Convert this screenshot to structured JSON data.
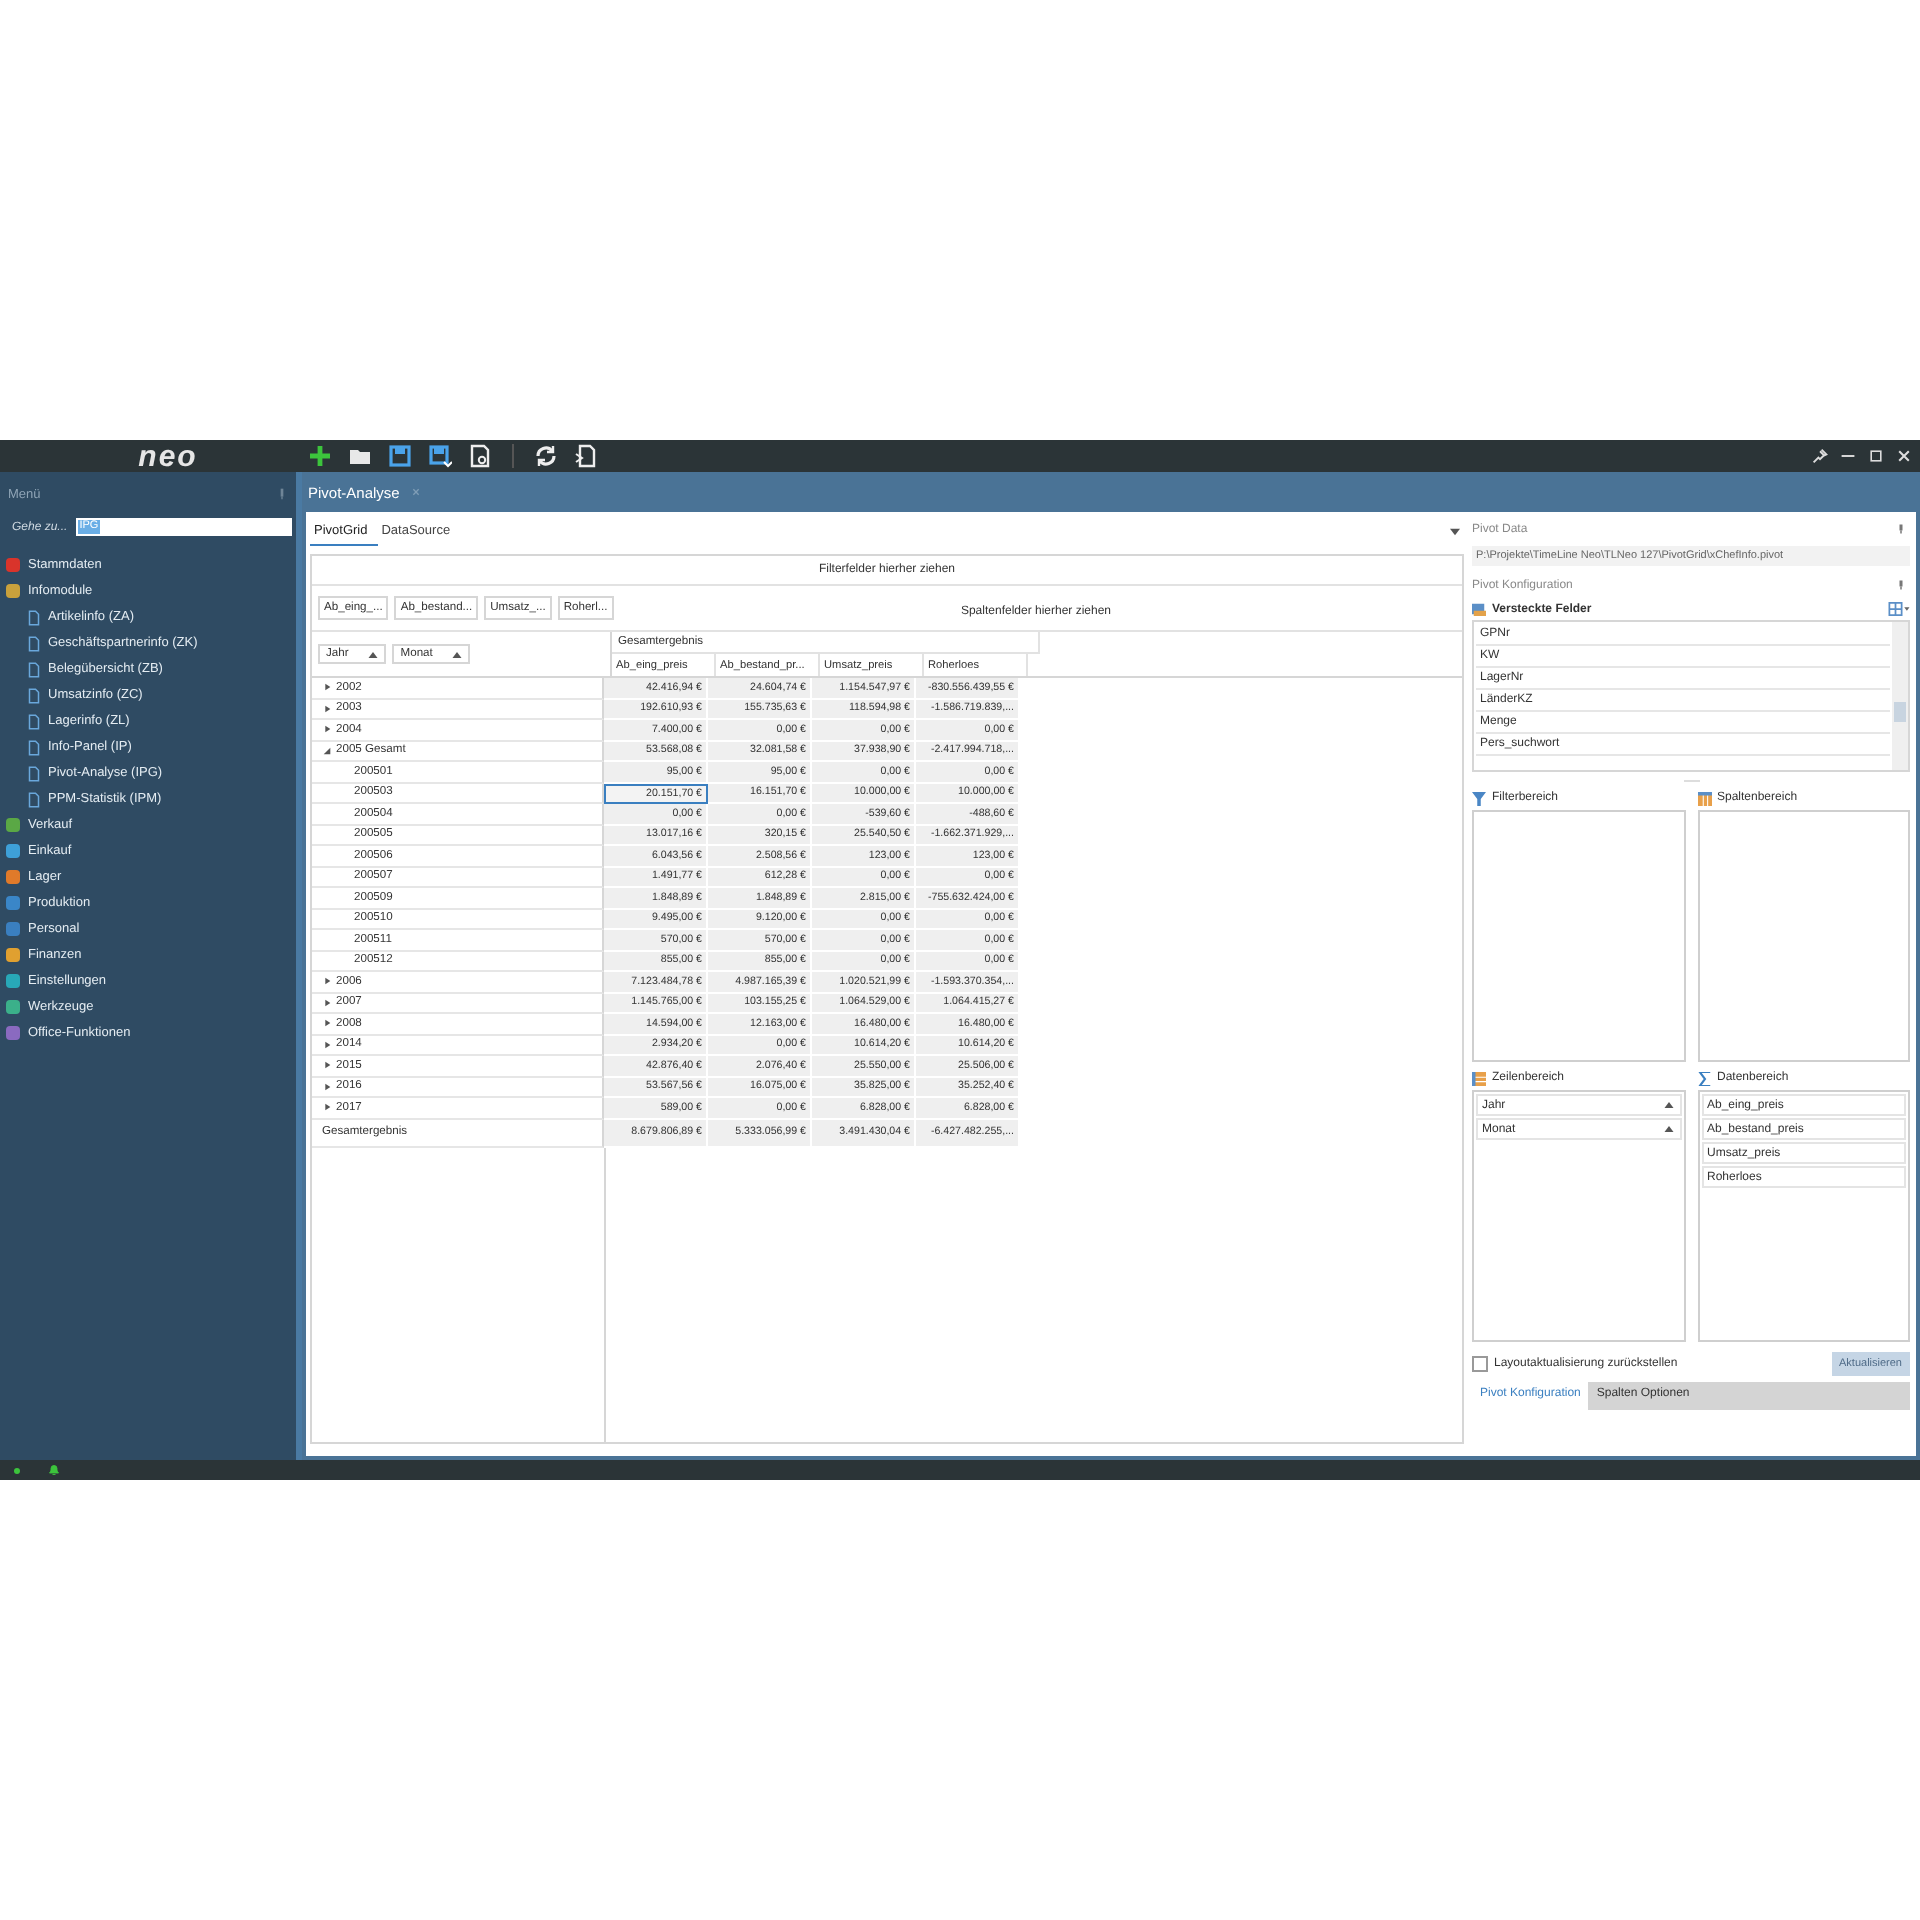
{
  "app": {
    "logo": "neo"
  },
  "sidebar": {
    "title": "Menü",
    "goto_label": "Gehe zu...",
    "goto_value": "IPG",
    "items": [
      {
        "label": "Stammdaten",
        "color": "#d9342b"
      },
      {
        "label": "Infomodule",
        "color": "#c9a13c",
        "children": [
          {
            "label": "Artikelinfo (ZA)"
          },
          {
            "label": "Geschäftspartnerinfo (ZK)"
          },
          {
            "label": "Belegübersicht (ZB)"
          },
          {
            "label": "Umsatzinfo (ZC)"
          },
          {
            "label": "Lagerinfo (ZL)"
          },
          {
            "label": "Info-Panel (IP)"
          },
          {
            "label": "Pivot-Analyse (IPG)"
          },
          {
            "label": "PPM-Statistik (IPM)"
          }
        ]
      },
      {
        "label": "Verkauf",
        "color": "#5aa845"
      },
      {
        "label": "Einkauf",
        "color": "#3ea0d8"
      },
      {
        "label": "Lager",
        "color": "#e07a2a"
      },
      {
        "label": "Produktion",
        "color": "#3a86c8"
      },
      {
        "label": "Personal",
        "color": "#3a7fc0"
      },
      {
        "label": "Finanzen",
        "color": "#e0a030"
      },
      {
        "label": "Einstellungen",
        "color": "#28a8b8"
      },
      {
        "label": "Werkzeuge",
        "color": "#3bb08a"
      },
      {
        "label": "Office-Funktionen",
        "color": "#8a6ac0"
      }
    ]
  },
  "document_tab": {
    "title": "Pivot-Analyse"
  },
  "view_tabs": [
    {
      "label": "PivotGrid",
      "selected": true
    },
    {
      "label": "DataSource",
      "selected": false
    }
  ],
  "pivot": {
    "filter_hint": "Filterfelder hierher ziehen",
    "data_fields": [
      "Ab_eing_...",
      "Ab_bestand...",
      "Umsatz_...",
      "Roherl..."
    ],
    "column_hint": "Spaltenfelder hierher ziehen",
    "row_fields": [
      "Jahr",
      "Monat"
    ],
    "grand_header": "Gesamtergebnis",
    "columns": [
      "Ab_eing_preis",
      "Ab_bestand_pr...",
      "Umsatz_preis",
      "Roherloes"
    ],
    "rows": [
      {
        "label": "2002",
        "expanded": false,
        "cells": [
          {
            "text": "42.416,94 €",
            "selected": false
          },
          {
            "text": "24.604,74 €",
            "selected": false
          },
          {
            "text": "1.154.547,97 €",
            "selected": false
          },
          {
            "text": "-830.556.439,55 €",
            "selected": false
          }
        ]
      },
      {
        "label": "2003",
        "expanded": false,
        "cells": [
          {
            "text": "192.610,93 €",
            "selected": false
          },
          {
            "text": "155.735,63 €",
            "selected": false
          },
          {
            "text": "118.594,98 €",
            "selected": false
          },
          {
            "text": "-1.586.719.839,...",
            "selected": false
          }
        ]
      },
      {
        "label": "2004",
        "expanded": false,
        "cells": [
          {
            "text": "7.400,00 €",
            "selected": false
          },
          {
            "text": "0,00 €",
            "selected": false
          },
          {
            "text": "0,00 €",
            "selected": false
          },
          {
            "text": "0,00 €",
            "selected": false
          }
        ]
      },
      {
        "label": "2005 Gesamt",
        "expanded": true,
        "cells": [
          {
            "text": "53.568,08 €",
            "selected": false
          },
          {
            "text": "32.081,58 €",
            "selected": false
          },
          {
            "text": "37.938,90 €",
            "selected": false
          },
          {
            "text": "-2.417.994.718,...",
            "selected": false
          }
        ],
        "children": [
          {
            "label": "200501",
            "cells": [
              {
                "text": "95,00 €",
                "selected": false
              },
              {
                "text": "95,00 €",
                "selected": false
              },
              {
                "text": "0,00 €",
                "selected": false
              },
              {
                "text": "0,00 €",
                "selected": false
              }
            ]
          },
          {
            "label": "200503",
            "cells": [
              {
                "text": "20.151,70 €",
                "selected": true
              },
              {
                "text": "16.151,70 €",
                "selected": false
              },
              {
                "text": "10.000,00 €",
                "selected": false
              },
              {
                "text": "10.000,00 €",
                "selected": false
              }
            ]
          },
          {
            "label": "200504",
            "cells": [
              {
                "text": "0,00 €",
                "selected": false
              },
              {
                "text": "0,00 €",
                "selected": false
              },
              {
                "text": "-539,60 €",
                "selected": false
              },
              {
                "text": "-488,60 €",
                "selected": false
              }
            ]
          },
          {
            "label": "200505",
            "cells": [
              {
                "text": "13.017,16 €",
                "selected": false
              },
              {
                "text": "320,15 €",
                "selected": false
              },
              {
                "text": "25.540,50 €",
                "selected": false
              },
              {
                "text": "-1.662.371.929,...",
                "selected": false
              }
            ]
          },
          {
            "label": "200506",
            "cells": [
              {
                "text": "6.043,56 €",
                "selected": false
              },
              {
                "text": "2.508,56 €",
                "selected": false
              },
              {
                "text": "123,00 €",
                "selected": false
              },
              {
                "text": "123,00 €",
                "selected": false
              }
            ]
          },
          {
            "label": "200507",
            "cells": [
              {
                "text": "1.491,77 €",
                "selected": false
              },
              {
                "text": "612,28 €",
                "selected": false
              },
              {
                "text": "0,00 €",
                "selected": false
              },
              {
                "text": "0,00 €",
                "selected": false
              }
            ]
          },
          {
            "label": "200509",
            "cells": [
              {
                "text": "1.848,89 €",
                "selected": false
              },
              {
                "text": "1.848,89 €",
                "selected": false
              },
              {
                "text": "2.815,00 €",
                "selected": false
              },
              {
                "text": "-755.632.424,00 €",
                "selected": false
              }
            ]
          },
          {
            "label": "200510",
            "cells": [
              {
                "text": "9.495,00 €",
                "selected": false
              },
              {
                "text": "9.120,00 €",
                "selected": false
              },
              {
                "text": "0,00 €",
                "selected": false
              },
              {
                "text": "0,00 €",
                "selected": false
              }
            ]
          },
          {
            "label": "200511",
            "cells": [
              {
                "text": "570,00 €",
                "selected": false
              },
              {
                "text": "570,00 €",
                "selected": false
              },
              {
                "text": "0,00 €",
                "selected": false
              },
              {
                "text": "0,00 €",
                "selected": false
              }
            ]
          },
          {
            "label": "200512",
            "cells": [
              {
                "text": "855,00 €",
                "selected": false
              },
              {
                "text": "855,00 €",
                "selected": false
              },
              {
                "text": "0,00 €",
                "selected": false
              },
              {
                "text": "0,00 €",
                "selected": false
              }
            ]
          }
        ]
      },
      {
        "label": "2006",
        "expanded": false,
        "cells": [
          {
            "text": "7.123.484,78 €",
            "selected": false
          },
          {
            "text": "4.987.165,39 €",
            "selected": false
          },
          {
            "text": "1.020.521,99 €",
            "selected": false
          },
          {
            "text": "-1.593.370.354,...",
            "selected": false
          }
        ]
      },
      {
        "label": "2007",
        "expanded": false,
        "cells": [
          {
            "text": "1.145.765,00 €",
            "selected": false
          },
          {
            "text": "103.155,25 €",
            "selected": false
          },
          {
            "text": "1.064.529,00 €",
            "selected": false
          },
          {
            "text": "1.064.415,27 €",
            "selected": false
          }
        ]
      },
      {
        "label": "2008",
        "expanded": false,
        "cells": [
          {
            "text": "14.594,00 €",
            "selected": false
          },
          {
            "text": "12.163,00 €",
            "selected": false
          },
          {
            "text": "16.480,00 €",
            "selected": false
          },
          {
            "text": "16.480,00 €",
            "selected": false
          }
        ]
      },
      {
        "label": "2014",
        "expanded": false,
        "cells": [
          {
            "text": "2.934,20 €",
            "selected": false
          },
          {
            "text": "0,00 €",
            "selected": false
          },
          {
            "text": "10.614,20 €",
            "selected": false
          },
          {
            "text": "10.614,20 €",
            "selected": false
          }
        ]
      },
      {
        "label": "2015",
        "expanded": false,
        "cells": [
          {
            "text": "42.876,40 €",
            "selected": false
          },
          {
            "text": "2.076,40 €",
            "selected": false
          },
          {
            "text": "25.550,00 €",
            "selected": false
          },
          {
            "text": "25.506,00 €",
            "selected": false
          }
        ]
      },
      {
        "label": "2016",
        "expanded": false,
        "cells": [
          {
            "text": "53.567,56 €",
            "selected": false
          },
          {
            "text": "16.075,00 €",
            "selected": false
          },
          {
            "text": "35.825,00 €",
            "selected": false
          },
          {
            "text": "35.252,40 €",
            "selected": false
          }
        ]
      },
      {
        "label": "2017",
        "expanded": false,
        "cells": [
          {
            "text": "589,00 €",
            "selected": false
          },
          {
            "text": "0,00 €",
            "selected": false
          },
          {
            "text": "6.828,00 €",
            "selected": false
          },
          {
            "text": "6.828,00 €",
            "selected": false
          }
        ]
      }
    ],
    "grand_total": {
      "label": "Gesamtergebnis",
      "cells": [
        {
          "text": "8.679.806,89 €",
          "selected": false
        },
        {
          "text": "5.333.056,99 €",
          "selected": false
        },
        {
          "text": "3.491.430,04 €",
          "selected": false
        },
        {
          "text": "-6.427.482.255,...",
          "selected": false
        }
      ]
    }
  },
  "config": {
    "pivot_data_title": "Pivot Data",
    "path": "P:\\Projekte\\TimeLine Neo\\TLNeo 127\\PivotGrid\\xChefInfo.pivot",
    "config_title": "Pivot Konfiguration",
    "hidden_title": "Versteckte Felder",
    "hidden_fields": [
      "GPNr",
      "KW",
      "LagerNr",
      "LänderKZ",
      "Menge",
      "Pers_suchwort"
    ],
    "areas": [
      {
        "kind": "filter",
        "title": "Filterbereich"
      },
      {
        "kind": "columns",
        "title": "Spaltenbereich"
      },
      {
        "kind": "rows",
        "title": "Zeilenbereich",
        "fields": [
          "Jahr",
          "Monat"
        ]
      },
      {
        "kind": "data",
        "title": "Datenbereich",
        "fields": [
          "Ab_eing_preis",
          "Ab_bestand_preis",
          "Umsatz_preis",
          "Roherloes"
        ]
      }
    ],
    "defer_update": {
      "label": "Layoutaktualisierung zurückstellen",
      "checked": false
    },
    "update_button": {
      "label": "Aktualisieren",
      "disabled": true
    },
    "bottom_tabs": [
      {
        "label": "Pivot Konfiguration",
        "selected": true
      },
      {
        "label": "Spalten Optionen",
        "selected": false
      }
    ]
  }
}
